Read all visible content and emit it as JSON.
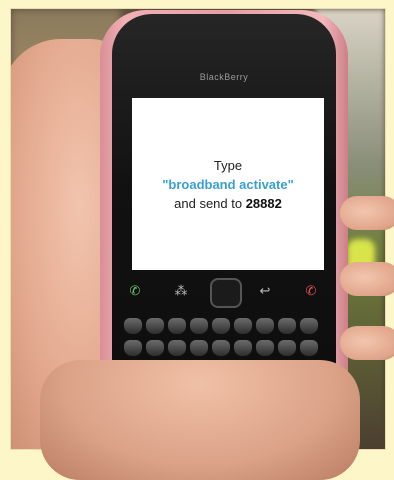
{
  "phone": {
    "brand": "BlackBerry",
    "screen": {
      "line1": "Type",
      "command": "\"broadband activate\"",
      "line3_prefix": "and send to ",
      "number": "28882"
    }
  },
  "colors": {
    "page_background": "#fdf6c9",
    "command_text": "#3aa0cf",
    "case": "#e79ea5"
  }
}
